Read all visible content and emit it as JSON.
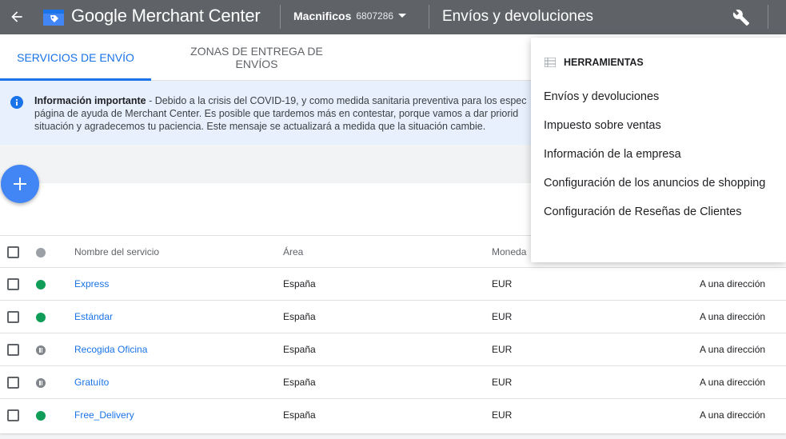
{
  "topbar": {
    "brand": "Google Merchant Center",
    "account_name": "Macnificos",
    "account_id": "6807286",
    "page_title": "Envíos y devoluciones"
  },
  "tabs": [
    {
      "label": "SERVICIOS DE ENVÍO",
      "active": true
    },
    {
      "label": "ZONAS DE ENTREGA DE ENVÍOS",
      "active": false
    }
  ],
  "banner": {
    "title": "Información importante",
    "line1": " - Debido a la crisis del COVID-19, y como medida sanitaria preventiva para los espec",
    "line2": "página de ayuda de Merchant Center. Es posible que tardemos más en contestar, porque vamos a dar priorid",
    "line3": "situación y agradecemos tu paciencia. Este mensaje se actualizará a medida que la situación cambie."
  },
  "table": {
    "headers": {
      "name": "Nombre del servicio",
      "area": "Área",
      "currency": "Moneda"
    },
    "rows": [
      {
        "status": "active",
        "name": "Express",
        "area": "España",
        "currency": "EUR",
        "destination": "A una dirección"
      },
      {
        "status": "active",
        "name": "Estándar",
        "area": "España",
        "currency": "EUR",
        "destination": "A una dirección"
      },
      {
        "status": "paused",
        "name": "Recogida Oficina",
        "area": "España",
        "currency": "EUR",
        "destination": "A una dirección"
      },
      {
        "status": "paused",
        "name": "Gratuíto",
        "area": "España",
        "currency": "EUR",
        "destination": "A una dirección"
      },
      {
        "status": "active",
        "name": "Free_Delivery",
        "area": "España",
        "currency": "EUR",
        "destination": "A una dirección"
      }
    ]
  },
  "tools_menu": {
    "title": "HERRAMIENTAS",
    "items": [
      "Envíos y devoluciones",
      "Impuesto sobre ventas",
      "Información de la empresa",
      "Configuración de los anuncios de shopping",
      "Configuración de Reseñas de Clientes"
    ]
  },
  "colors": {
    "topbar": "#5f6368",
    "accent": "#1a73e8",
    "fab": "#4285f4",
    "status_active": "#0f9d58",
    "status_paused": "#80868b",
    "banner": "#e8f0fe"
  },
  "icons": [
    "arrow-back-icon",
    "merchant-center-logo-icon",
    "dropdown-arrow-icon",
    "wrench-icon",
    "info-icon",
    "add-icon",
    "tools-menu-icon"
  ]
}
